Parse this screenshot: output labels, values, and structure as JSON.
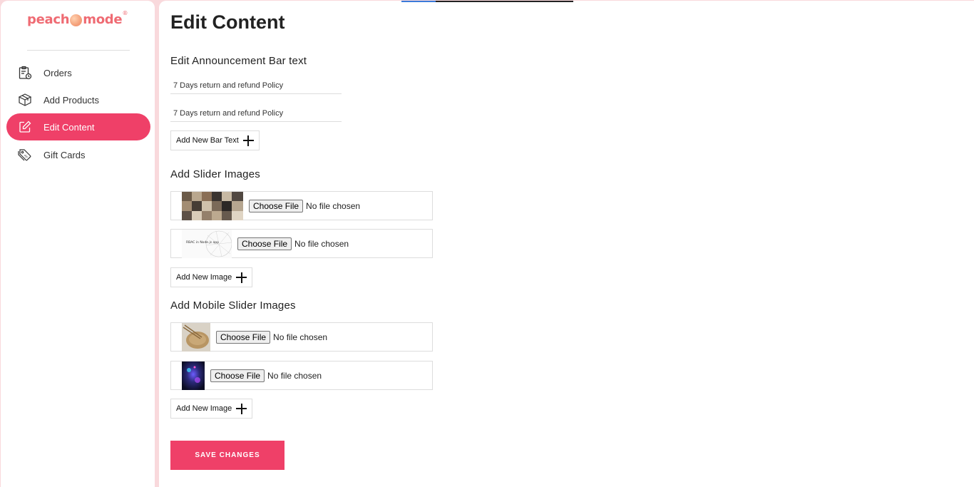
{
  "brand": {
    "name_left": "peach",
    "name_right": "mode",
    "registered": "®"
  },
  "sidebar": {
    "items": [
      {
        "label": "Orders",
        "icon": "orders-clipboard-icon"
      },
      {
        "label": "Add Products",
        "icon": "box-icon"
      },
      {
        "label": "Edit Content",
        "icon": "edit-icon",
        "active": true
      },
      {
        "label": "Gift Cards",
        "icon": "tag-icon"
      }
    ]
  },
  "page": {
    "title": "Edit Content",
    "announcement": {
      "title": "Edit Announcement Bar text",
      "fields": [
        "7 Days return and refund Policy",
        "7 Days return and refund Policy"
      ],
      "add_label": "Add New Bar Text"
    },
    "slider": {
      "title": "Add Slider Images",
      "items": [
        {
          "thumb": "photo-grid-thumbnail",
          "button": "Choose File",
          "status": "No file chosen"
        },
        {
          "thumb": "document-globe-thumbnail",
          "thumb_text": "RBAC in Node.js app",
          "button": "Choose File",
          "status": "No file chosen"
        }
      ],
      "add_label": "Add New Image"
    },
    "mobile_slider": {
      "title": "Add Mobile Slider Images",
      "items": [
        {
          "thumb": "bowl-photo-thumbnail",
          "button": "Choose File",
          "status": "No file chosen"
        },
        {
          "thumb": "neon-abstract-thumbnail",
          "button": "Choose File",
          "status": "No file chosen"
        }
      ],
      "add_label": "Add New Image"
    },
    "save_label": "SAVE CHANGES"
  },
  "colors": {
    "accent": "#ef4068",
    "background": "#f9d9dc",
    "brand": "#ef6b73"
  }
}
